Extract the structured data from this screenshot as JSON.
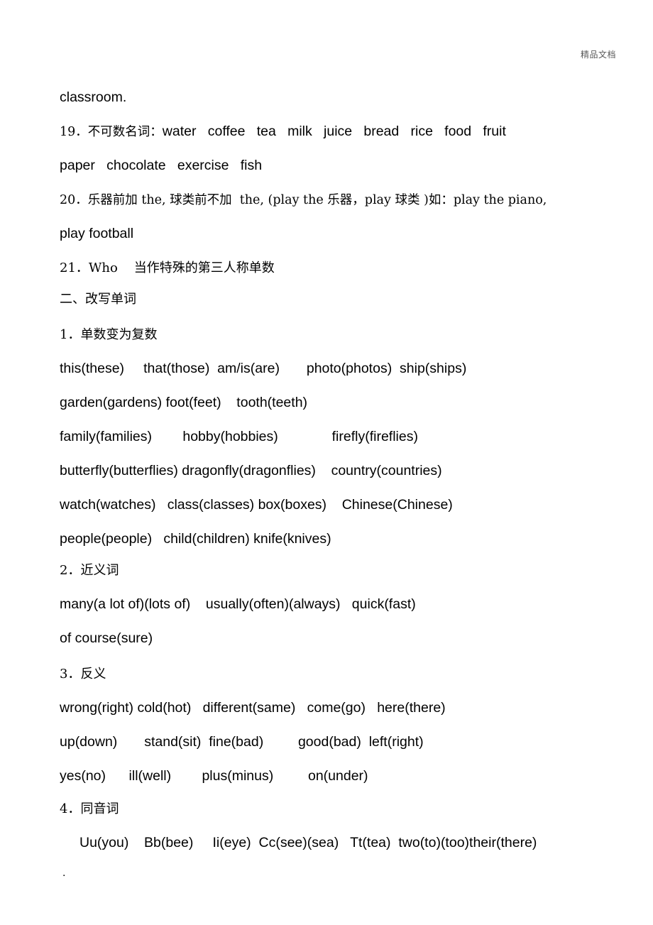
{
  "page": {
    "watermark": "精品文档",
    "trailing_mark": "."
  },
  "content": {
    "line_classroom": "classroom.",
    "item19_label": "19．不可数名词：",
    "item19_words": "water   coffee   tea   milk   juice   bread   rice   food   fruit",
    "item19_words_cont": "paper   chocolate   exercise   fish",
    "item20": "20．乐器前加 the, 球类前不加  the, (play the 乐器，play 球类 )如：play the piano,",
    "item20_cont": "play football",
    "item21": "21．Who    当作特殊的第三人称单数",
    "section_two": "二、改写单词",
    "sub1_heading": "1．单数变为复数",
    "sub1_line1": "this(these)     that(those)  am/is(are)       photo(photos)  ship(ships)",
    "sub1_line2": "garden(gardens) foot(feet)    tooth(teeth)",
    "sub1_line3": "family(families)        hobby(hobbies)              firefly(fireflies)",
    "sub1_line4": "butterfly(butterflies) dragonfly(dragonflies)    country(countries)",
    "sub1_line5": "watch(watches)   class(classes) box(boxes)    Chinese(Chinese)",
    "sub1_line6": "people(people)   child(children) knife(knives)",
    "sub2_heading": "2．近义词",
    "sub2_line1": "many(a lot of)(lots of)    usually(often)(always)   quick(fast)",
    "sub2_line2": "of course(sure)",
    "sub3_heading": "3．反义",
    "sub3_line1": "wrong(right) cold(hot)   different(same)   come(go)   here(there)",
    "sub3_line2": "up(down)       stand(sit)  fine(bad)         good(bad)  left(right)",
    "sub3_line3": "yes(no)      ill(well)        plus(minus)         on(under)",
    "sub4_heading": "4．同音词",
    "sub4_line1": "Uu(you)    Bb(bee)     Ii(eye)  Cc(see)(sea)   Tt(tea)  two(to)(too)their(there)"
  }
}
